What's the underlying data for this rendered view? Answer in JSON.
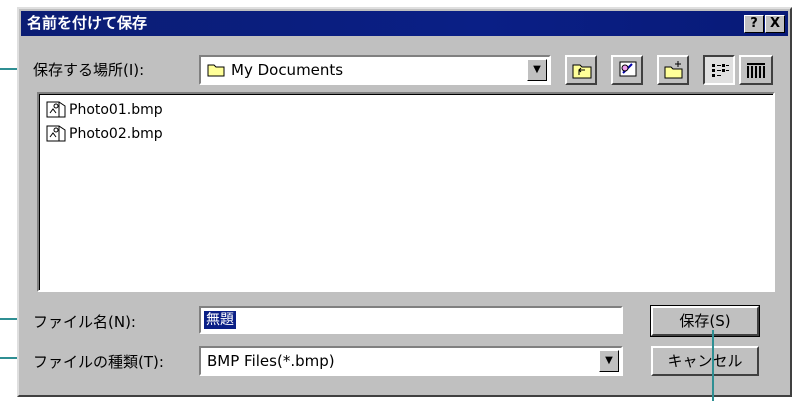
{
  "window": {
    "title": "名前を付けて保存",
    "help_label": "?",
    "close_label": "X"
  },
  "location": {
    "label": "保存する場所(I):",
    "value": "My Documents",
    "dropdown_arrow": "▼"
  },
  "toolbar": {
    "icons": [
      "up-folder-icon",
      "desktop-icon",
      "new-folder-icon",
      "list-view-icon",
      "details-view-icon"
    ]
  },
  "files": [
    {
      "name": "Photo01.bmp",
      "icon": "bitmap-file-icon"
    },
    {
      "name": "Photo02.bmp",
      "icon": "bitmap-file-icon"
    }
  ],
  "filename": {
    "label": "ファイル名(N):",
    "value": "無題"
  },
  "filetype": {
    "label": "ファイルの種類(T):",
    "value": "BMP Files(*.bmp)",
    "dropdown_arrow": "▼"
  },
  "buttons": {
    "save": "保存(S)",
    "cancel": "キャンセル"
  },
  "colors": {
    "titlebar": "#0a1f86",
    "face": "#c0c0c0",
    "callout": "#2f8f93"
  }
}
